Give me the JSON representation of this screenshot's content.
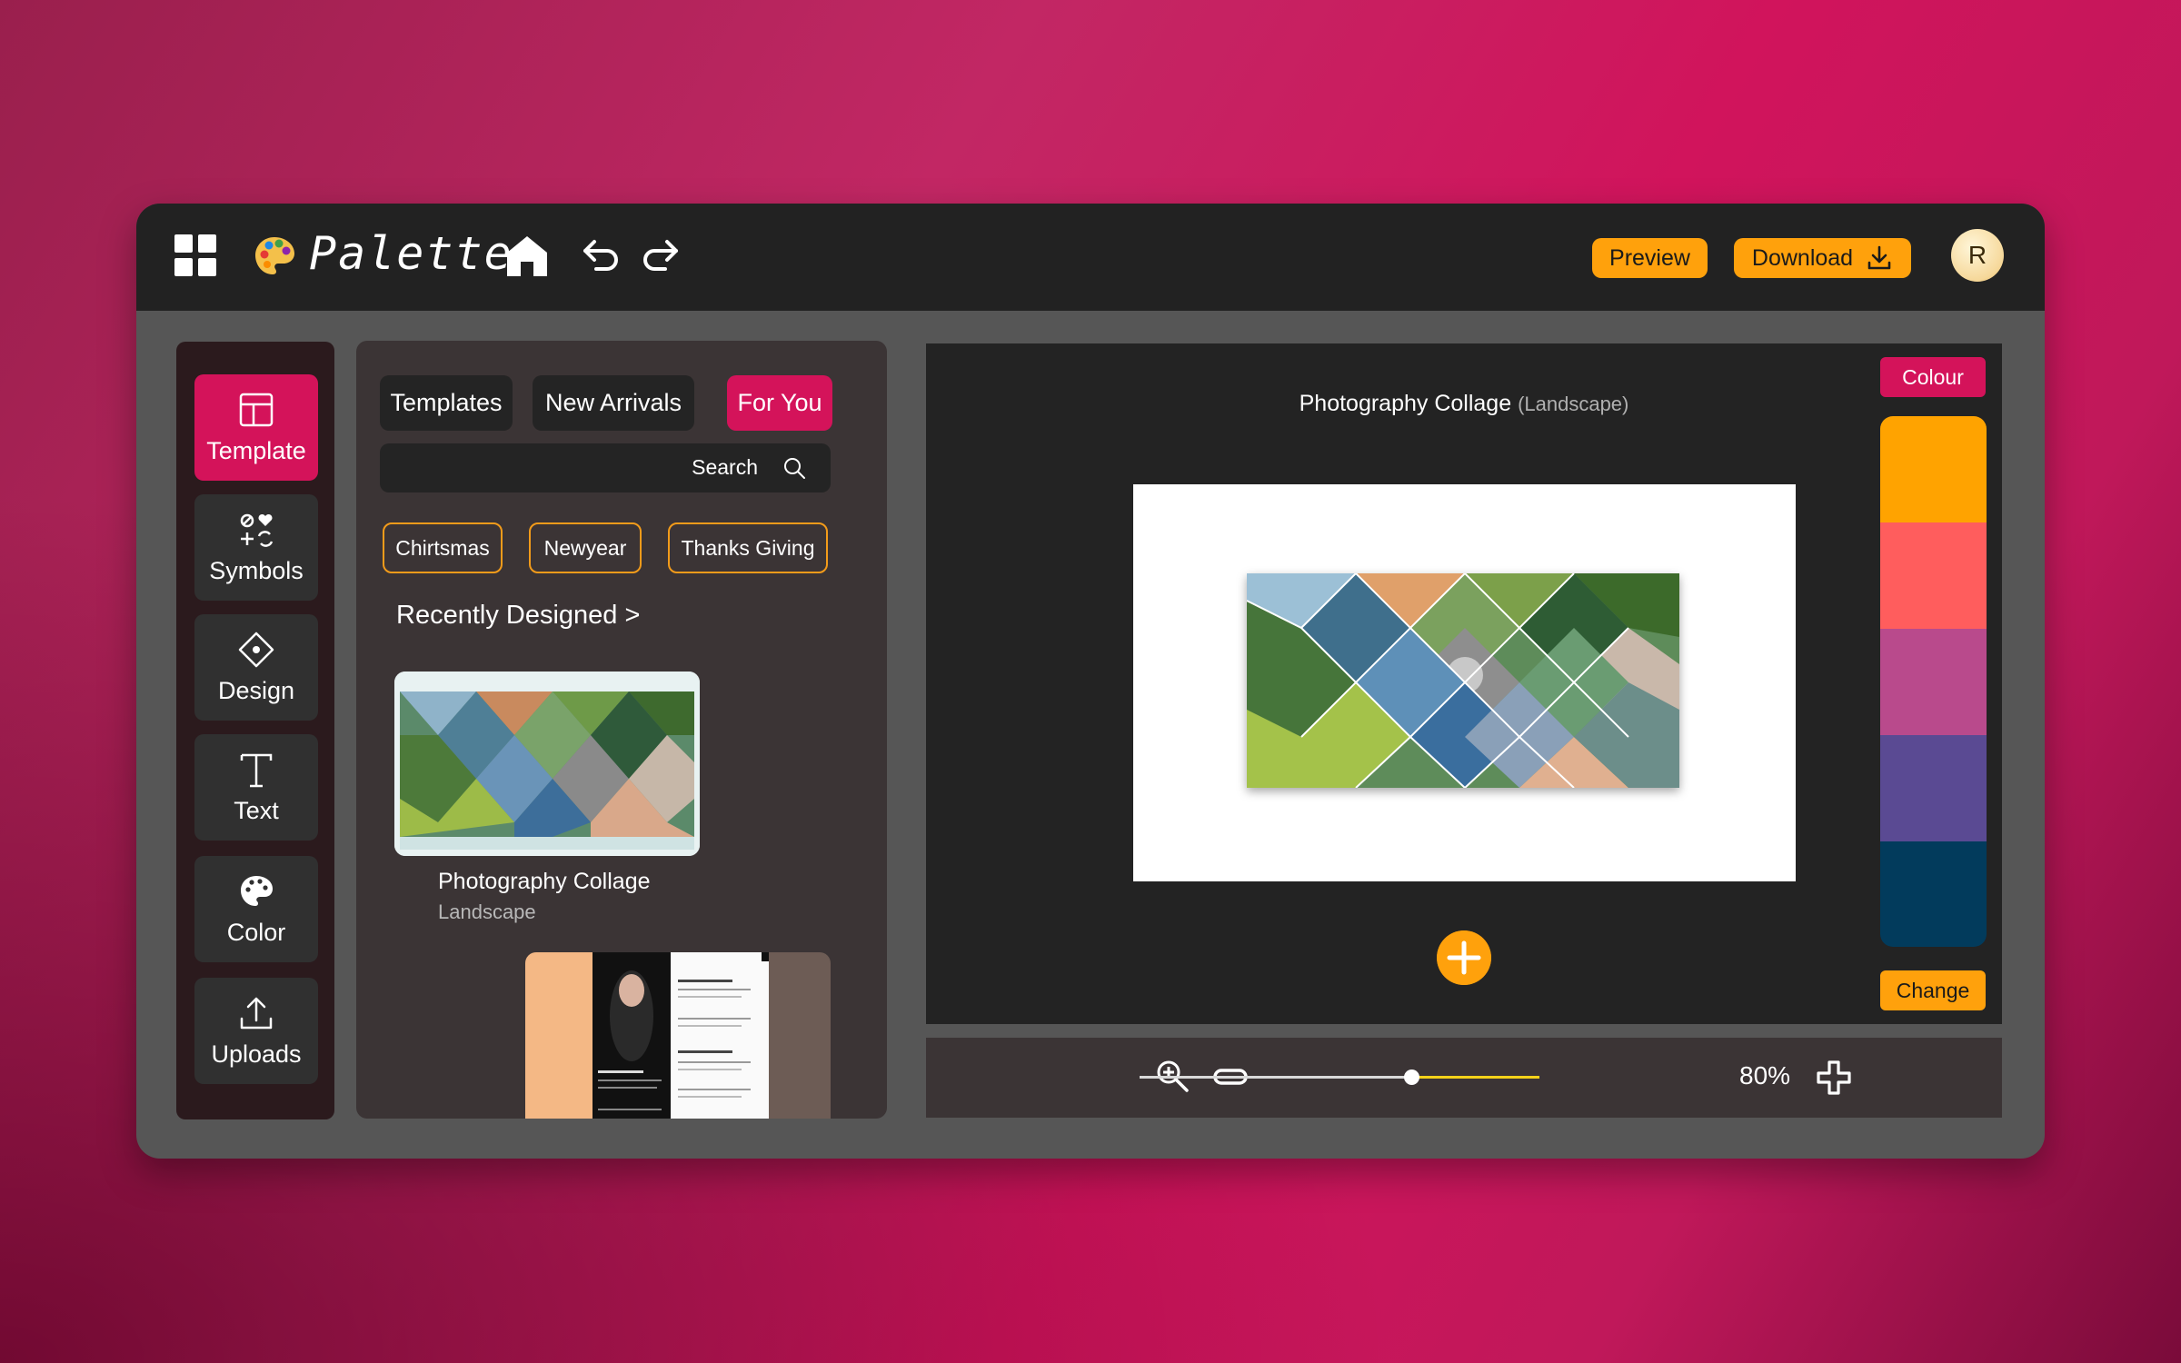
{
  "app": {
    "name": "Palette",
    "preview_label": "Preview",
    "download_label": "Download",
    "avatar_initial": "R"
  },
  "sidebar": {
    "items": [
      {
        "label": "Template",
        "icon": "template-icon",
        "active": true
      },
      {
        "label": "Symbols",
        "icon": "symbols-icon",
        "active": false
      },
      {
        "label": "Design",
        "icon": "design-icon",
        "active": false
      },
      {
        "label": "Text",
        "icon": "text-icon",
        "active": false
      },
      {
        "label": "Color",
        "icon": "palette-icon",
        "active": false
      },
      {
        "label": "Uploads",
        "icon": "upload-icon",
        "active": false
      }
    ]
  },
  "panel": {
    "tabs": [
      {
        "label": "Templates",
        "active": false
      },
      {
        "label": "New Arrivals",
        "active": false
      },
      {
        "label": "For You",
        "active": true
      }
    ],
    "search_label": "Search",
    "chips": [
      "Chirtsmas",
      "Newyear",
      "Thanks Giving"
    ],
    "section_title": "Recently Designed >",
    "recent": [
      {
        "title": "Photography Collage",
        "subtitle": "Landscape"
      }
    ]
  },
  "canvas": {
    "title": "Photography Collage",
    "subtitle": "(Landscape)"
  },
  "colours": {
    "colour_label": "Colour",
    "change_label": "Change",
    "swatches": [
      "#ffa300",
      "#ff5d5d",
      "#b94a8c",
      "#5a4a93",
      "#023b5c"
    ]
  },
  "zoom": {
    "value_label": "80%",
    "level": 0.8
  },
  "theme": {
    "accent": "#d4135a",
    "orange": "#ffa10c"
  }
}
